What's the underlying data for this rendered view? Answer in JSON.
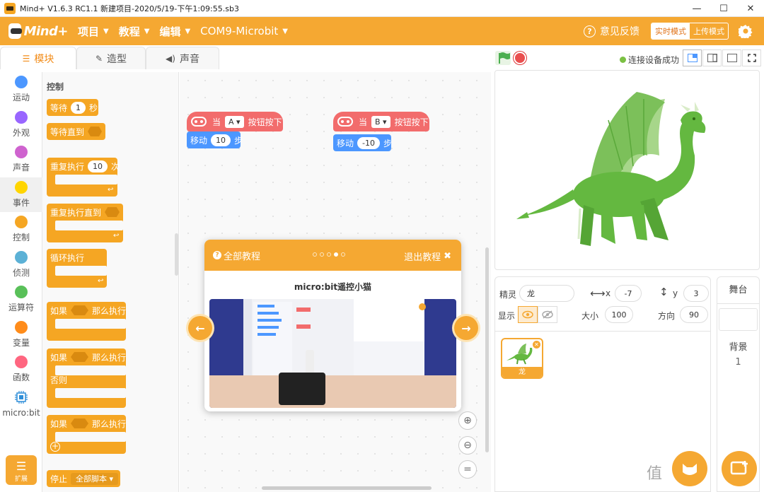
{
  "window": {
    "title": "Mind+ V1.6.3 RC1.1   新建项目-2020/5/19-下午1:09:55.sb3",
    "buttons": [
      "—",
      "☐",
      "✕"
    ]
  },
  "menubar": {
    "logo": "Mind+",
    "items": [
      {
        "label": "项目"
      },
      {
        "label": "教程"
      },
      {
        "label": "编辑"
      },
      {
        "label": "COM9-Microbit"
      }
    ],
    "feedback": "意见反馈",
    "mode_realtime": "实时模式",
    "mode_upload": "上传模式",
    "colors": {
      "accent": "#f5a832",
      "motion": "#4c97ff",
      "event": "#f26c6c"
    }
  },
  "tabs": [
    {
      "label": "模块",
      "icon": "blocks-icon",
      "active": true
    },
    {
      "label": "造型",
      "icon": "brush-icon",
      "active": false
    },
    {
      "label": "声音",
      "icon": "speaker-icon",
      "active": false
    }
  ],
  "stage_controls": {
    "connection": "连接设备成功"
  },
  "categories": [
    {
      "label": "运动",
      "color": "#4c97ff"
    },
    {
      "label": "外观",
      "color": "#9966ff"
    },
    {
      "label": "声音",
      "color": "#cf63cf"
    },
    {
      "label": "事件",
      "color": "#ffd500",
      "selected": true
    },
    {
      "label": "控制",
      "color": "#f5a623"
    },
    {
      "label": "侦测",
      "color": "#5cb1d6"
    },
    {
      "label": "运算符",
      "color": "#59c059"
    },
    {
      "label": "变量",
      "color": "#ff8c1a"
    },
    {
      "label": "函数",
      "color": "#ff6680"
    },
    {
      "label": "micro:bit",
      "color": "#2e8ed8"
    }
  ],
  "expand_label": "扩展",
  "palette": {
    "title": "控制",
    "wait_label": "等待",
    "wait_value": "1",
    "wait_unit": "秒",
    "wait_until": "等待直到",
    "repeat_label": "重复执行",
    "repeat_value": "10",
    "repeat_unit": "次",
    "repeat_until": "重复执行直到",
    "forever": "循环执行",
    "if_label": "如果",
    "then_label": "那么执行",
    "else_label": "否则",
    "stop_label": "停止",
    "stop_option": "全部脚本"
  },
  "scripts": [
    {
      "hat_when": "当",
      "button": "A",
      "hat_suffix": "按钮按下",
      "move_label": "移动",
      "move_value": "10",
      "move_unit": "步"
    },
    {
      "hat_when": "当",
      "button": "B",
      "hat_suffix": "按钮按下",
      "move_label": "移动",
      "move_value": "-10",
      "move_unit": "步"
    }
  ],
  "tutorial": {
    "all": "全部教程",
    "exit": "退出教程",
    "title": "micro:bit遥控小猫",
    "pages": 5,
    "current_page": 4
  },
  "sprite": {
    "sprite_label": "精灵",
    "name": "龙",
    "x_label": "x",
    "x": "-7",
    "y_label": "y",
    "y": "3",
    "show_label": "显示",
    "size_label": "大小",
    "size": "100",
    "direction_label": "方向",
    "direction": "90",
    "thumb_name": "龙"
  },
  "stage_panel": {
    "title": "舞台",
    "backdrop_label": "背景",
    "backdrop_count": "1"
  }
}
